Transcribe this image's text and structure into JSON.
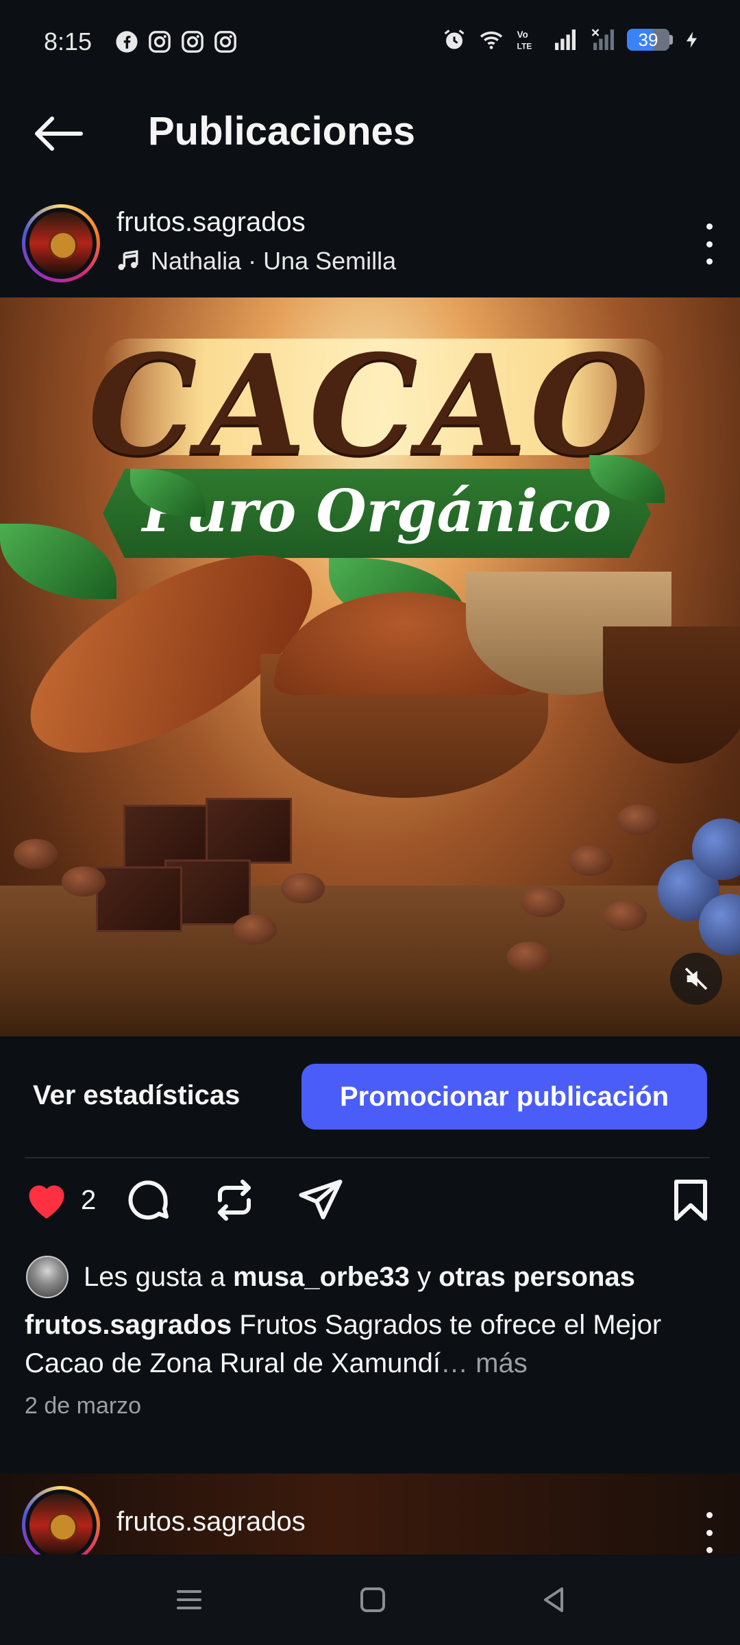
{
  "status_bar": {
    "time": "8:15",
    "battery": "39",
    "app_icons": [
      "facebook-icon",
      "instagram-icon",
      "instagram-icon",
      "instagram-icon"
    ],
    "right_icons": [
      "alarm-icon",
      "wifi-icon",
      "volte-icon",
      "signal-icon",
      "signal-empty-icon",
      "battery-icon",
      "charging-icon"
    ]
  },
  "header": {
    "title": "Publicaciones"
  },
  "post": {
    "username": "frutos.sagrados",
    "audio": "Nathalia · Una Semilla",
    "media": {
      "headline": "CACAO",
      "subline": "Puro Orgánico"
    },
    "view_stats_label": "Ver estadísticas",
    "promote_label": "Promocionar publicación",
    "like_count": "2",
    "likes_prefix": "Les gusta a ",
    "likes_user": "musa_orbe33",
    "likes_join": " y ",
    "likes_others": "otras personas",
    "caption_user": "frutos.sagrados",
    "caption_text": " Frutos Sagrados te ofrece el Mejor Cacao de Zona Rural de Xamundí",
    "caption_ellipsis": "…",
    "caption_more": " más",
    "date": "2 de marzo"
  },
  "next_post": {
    "username": "frutos.sagrados"
  },
  "colors": {
    "background": "#0c1014",
    "accent_button": "#4a5df9",
    "like_red": "#ff3040",
    "muted_text": "#9aa0a6"
  }
}
